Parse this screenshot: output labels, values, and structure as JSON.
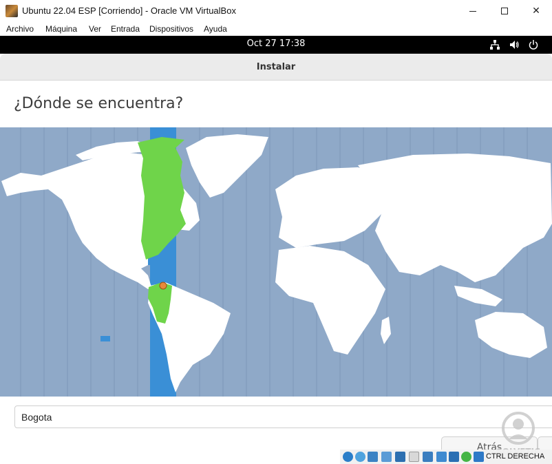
{
  "window": {
    "title": "Ubuntu 22.04 ESP [Corriendo] - Oracle VM VirtualBox",
    "minimize_icon": "minimize-icon",
    "maximize_icon": "maximize-icon",
    "close_icon": "close-icon"
  },
  "menubar": {
    "items": [
      {
        "label": "Archivo"
      },
      {
        "label": "Máquina"
      },
      {
        "label": "Ver"
      },
      {
        "label": "Entrada"
      },
      {
        "label": "Dispositivos"
      },
      {
        "label": "Ayuda"
      }
    ]
  },
  "topbar": {
    "clock": "Oct 27  17:38",
    "icons": [
      "network-icon",
      "volume-icon",
      "power-icon"
    ]
  },
  "installer": {
    "window_title": "Instalar",
    "heading": "¿Dónde se encuentra?",
    "location_value": "Bogota",
    "back_label": "Atrás",
    "next_label": "C"
  },
  "map": {
    "ocean_color": "#8fa9c8",
    "land_color": "#ffffff",
    "selected_zone_color": "#3a8fd6",
    "selected_land_color": "#6fd44a",
    "marker_color": "#e8893a"
  },
  "statusbar": {
    "host_key": "CTRL DERECHA"
  },
  "watermark": {
    "text": "SOLVETIC"
  }
}
